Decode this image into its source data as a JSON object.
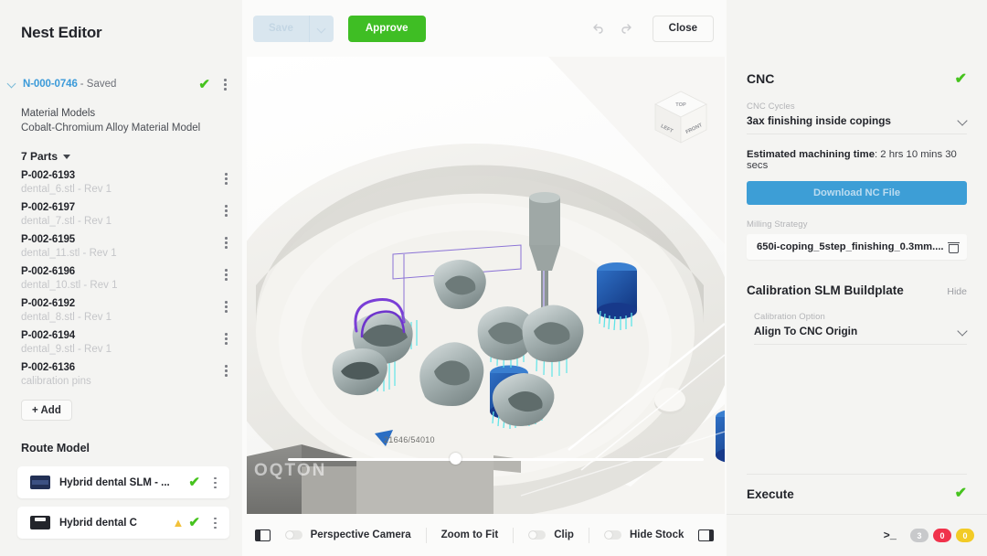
{
  "sidebar": {
    "title": "Nest Editor",
    "nest": {
      "id": "N-000-0746",
      "state": "- Saved"
    },
    "material": {
      "label": "Material Models",
      "value": "Cobalt-Chromium Alloy Material Model"
    },
    "parts_header": "7 Parts",
    "parts": [
      {
        "id": "P-002-6193",
        "file": "dental_6.stl - Rev 1"
      },
      {
        "id": "P-002-6197",
        "file": "dental_7.stl - Rev 1"
      },
      {
        "id": "P-002-6195",
        "file": "dental_11.stl - Rev 1"
      },
      {
        "id": "P-002-6196",
        "file": "dental_10.stl - Rev 1"
      },
      {
        "id": "P-002-6192",
        "file": "dental_8.stl - Rev 1"
      },
      {
        "id": "P-002-6194",
        "file": "dental_9.stl - Rev 1"
      },
      {
        "id": "P-002-6136",
        "file": "calibration pins"
      }
    ],
    "add_label": "+ Add",
    "route_header": "Route Model",
    "routes": [
      {
        "label": "Hybrid dental SLM - ...",
        "icon": "buildplate-icon",
        "warning": false
      },
      {
        "label": "Hybrid dental C",
        "icon": "printer-icon",
        "warning": true
      }
    ]
  },
  "toolbar": {
    "save_label": "Save",
    "approve_label": "Approve",
    "close_label": "Close",
    "undo_icon": "undo-icon",
    "redo_icon": "redo-icon"
  },
  "viewport": {
    "watermark": "OQTON",
    "slider_value": "21646/54010",
    "slider_percent": 39,
    "viewcube": {
      "top": "TOP",
      "left": "LEFT",
      "front": "FRONT"
    }
  },
  "bottombar": {
    "left_panel_icon": "panel-left-icon",
    "right_panel_icon": "panel-right-icon",
    "perspective_camera": "Perspective Camera",
    "zoom_to_fit": "Zoom to Fit",
    "clip": "Clip",
    "hide_stock": "Hide Stock"
  },
  "rightpanel": {
    "cnc": {
      "title": "CNC",
      "cycles_label": "CNC Cycles",
      "cycles_value": "3ax finishing inside copings",
      "estimate_label": "Estimated machining time",
      "estimate_value": ": 2 hrs 10 mins 30 secs",
      "download_label": "Download NC File",
      "milling_label": "Milling Strategy",
      "milling_value": "650i-coping_5step_finishing_0.3mm...."
    },
    "calibration": {
      "title": "Calibration SLM Buildplate",
      "hide_label": "Hide",
      "option_label": "Calibration Option",
      "option_value": "Align To CNC Origin"
    },
    "execute": {
      "title": "Execute"
    },
    "status": {
      "console_icon": ">_",
      "info_count": "3",
      "error_count": "0",
      "warning_count": "0"
    }
  },
  "colors": {
    "accent_blue": "#3d9ed6",
    "approve_green": "#3fbe24",
    "check_green": "#46c31e",
    "error_red": "#f0324b",
    "warning_yellow": "#f2cb26"
  }
}
